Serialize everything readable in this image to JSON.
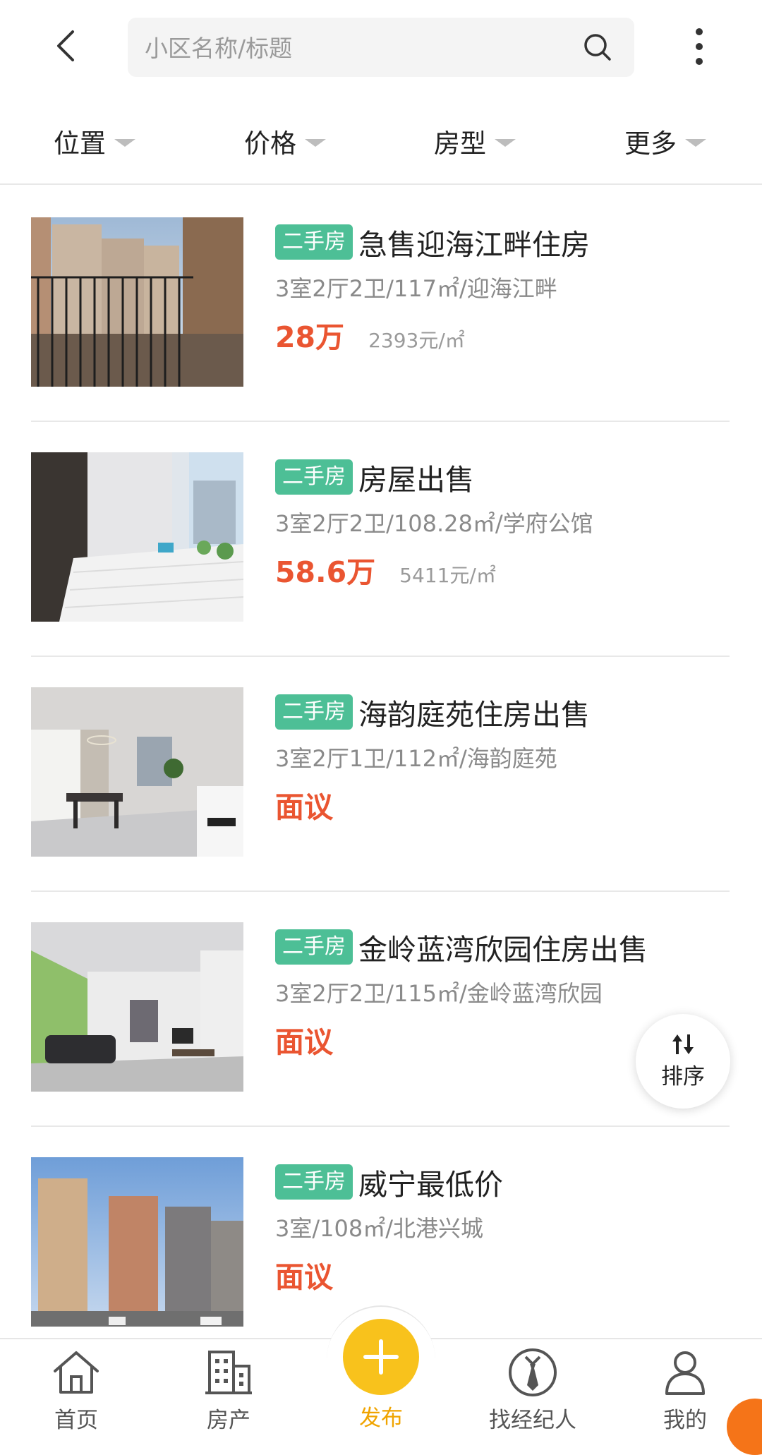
{
  "header": {
    "search_placeholder": "小区名称/标题"
  },
  "filters": [
    {
      "label": "位置"
    },
    {
      "label": "价格"
    },
    {
      "label": "房型"
    },
    {
      "label": "更多"
    }
  ],
  "listings": [
    {
      "tag": "二手房",
      "title": "急售迎海江畔住房",
      "details": "3室2厅2卫/117㎡/迎海江畔",
      "price": "28万",
      "unit_price": "2393元/㎡"
    },
    {
      "tag": "二手房",
      "title": "房屋出售",
      "details": "3室2厅2卫/108.28㎡/学府公馆",
      "price": "58.6万",
      "unit_price": "5411元/㎡"
    },
    {
      "tag": "二手房",
      "title": "海韵庭苑住房出售",
      "details": "3室2厅1卫/112㎡/海韵庭苑",
      "price": "面议",
      "unit_price": ""
    },
    {
      "tag": "二手房",
      "title": "金岭蓝湾欣园住房出售",
      "details": "3室2厅2卫/115㎡/金岭蓝湾欣园",
      "price": "面议",
      "unit_price": ""
    },
    {
      "tag": "二手房",
      "title": "威宁最低价",
      "details": "3室/108㎡/北港兴城",
      "price": "面议",
      "unit_price": ""
    }
  ],
  "sort_button": {
    "label": "排序"
  },
  "bottom_nav": {
    "home": "首页",
    "property": "房产",
    "publish": "发布",
    "agent": "找经纪人",
    "mine": "我的"
  },
  "colors": {
    "tag": "#4dbf96",
    "price": "#ea5531",
    "publish": "#f8c21c"
  }
}
